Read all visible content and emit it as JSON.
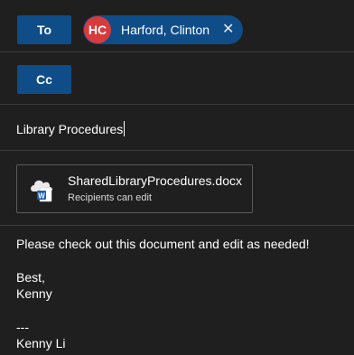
{
  "to": {
    "button_label": "To",
    "recipient": {
      "initials": "HC",
      "name": "Harford, Clinton",
      "avatar_color": "#d83b3b"
    }
  },
  "cc": {
    "button_label": "Cc"
  },
  "subject": {
    "value": "Library Procedures"
  },
  "attachment": {
    "file_name": "SharedLibraryProcedures.docx",
    "permission": "Recipients can edit",
    "icon": "word-cloud-doc-icon"
  },
  "message": {
    "line1": "Please check out this document and edit as needed!",
    "closing": "Best,",
    "signoff_name": "Kenny",
    "separator": "---",
    "signature_name": "Kenny Li"
  },
  "colors": {
    "background": "#1f1f1f",
    "accent": "#0f4d89",
    "divider": "#3a3a3a"
  }
}
